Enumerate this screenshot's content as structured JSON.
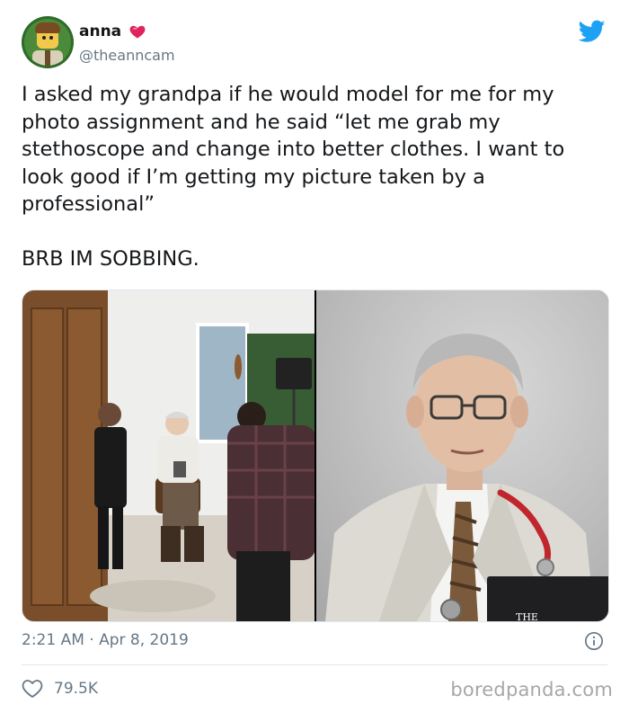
{
  "user": {
    "name": "anna",
    "handle": "@theanncam",
    "avatar_icon": "lego-minifigure-avatar",
    "badge_icon": "heart-icon"
  },
  "tweet": {
    "text": "I asked my grandpa if he would model for me for my photo assignment and he said “let me grab my stethoscope and change into better clothes. I want to look good if I’m getting my picture taken by a professional”\n\nBRB IM SOBBING."
  },
  "media": {
    "photos": [
      {
        "name": "behind-the-scenes-photo"
      },
      {
        "name": "grandpa-portrait-photo"
      }
    ],
    "book_cover_text": "THE"
  },
  "footer": {
    "timestamp": "2:21 AM · Apr 8, 2019",
    "likes": "79.5K"
  },
  "watermark": "boredpanda.com",
  "colors": {
    "twitter_blue": "#1da1f2",
    "heart_pink": "#e0245e",
    "secondary_text": "#657786",
    "border": "#e1e8ed"
  }
}
